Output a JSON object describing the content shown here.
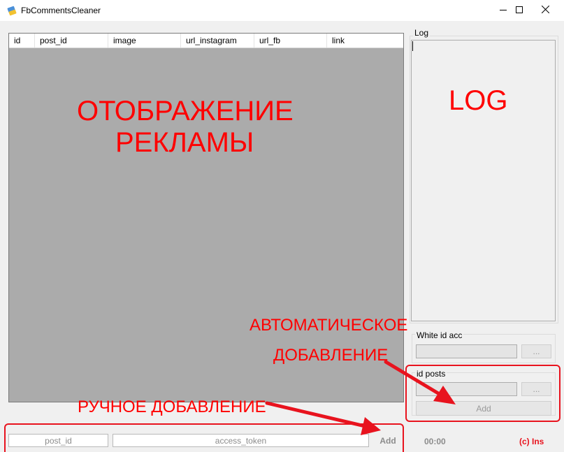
{
  "window": {
    "title": "FbCommentsCleaner",
    "icon": "broom-app-icon"
  },
  "grid": {
    "columns": [
      "id",
      "post_id",
      "image",
      "url_instagram",
      "url_fb",
      "link"
    ]
  },
  "log": {
    "label": "Log"
  },
  "white_id_acc": {
    "label": "White id acc",
    "browse_label": "..."
  },
  "id_posts": {
    "label": "id posts",
    "browse_label": "...",
    "add_label": "Add"
  },
  "manual": {
    "post_id_placeholder": "post_id",
    "access_token_placeholder": "access_token",
    "add_label": "Add"
  },
  "status": {
    "timer": "00:00",
    "copyright": "(c) Ins"
  },
  "annotations": {
    "ads_line1": "ОТОБРАЖЕНИЕ",
    "ads_line2": "РЕКЛАМЫ",
    "log": "LOG",
    "auto_line1": "АВТОМАТИЧЕСКОЕ",
    "auto_line2": "ДОБАВЛЕНИЕ",
    "manual": "РУЧНОЕ ДОБАВЛЕНИЕ",
    "color": "#ff0000"
  }
}
